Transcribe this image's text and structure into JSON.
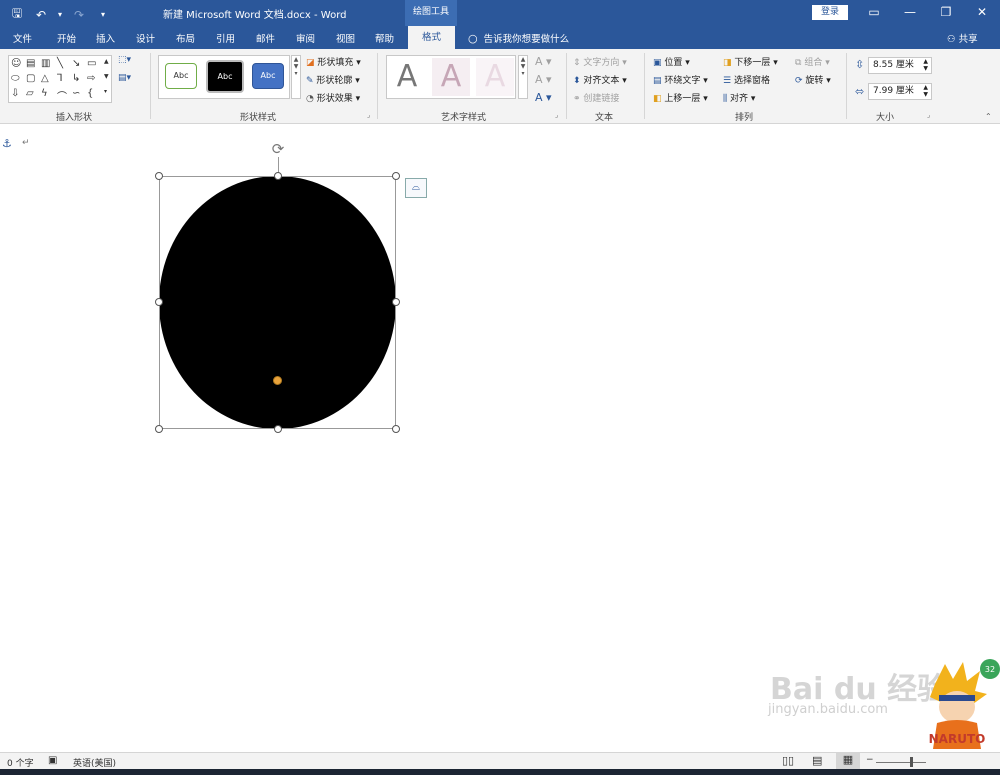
{
  "window": {
    "title": "新建 Microsoft Word 文档.docx  -  Word",
    "contextual_tools": "绘图工具",
    "login_label": "登录",
    "controls": {
      "display_options": "▭",
      "minimize": "—",
      "restore": "❐",
      "close": "✕"
    }
  },
  "qat": {
    "save": "🖫",
    "undo": "↶",
    "undo_drop": "▾",
    "redo": "↷",
    "customize": "▾"
  },
  "tabs": [
    {
      "label": "文件"
    },
    {
      "label": "开始"
    },
    {
      "label": "插入"
    },
    {
      "label": "设计"
    },
    {
      "label": "布局"
    },
    {
      "label": "引用"
    },
    {
      "label": "邮件"
    },
    {
      "label": "审阅"
    },
    {
      "label": "视图"
    },
    {
      "label": "帮助"
    },
    {
      "label": "格式"
    }
  ],
  "tell_me": "告诉我你想要做什么",
  "share": "共享",
  "ribbon": {
    "groups": {
      "insert_shapes": "插入形状",
      "shape_styles": "形状样式",
      "wordart_styles": "艺术字样式",
      "text": "文本",
      "arrange": "排列",
      "size": "大小"
    },
    "style_presets": [
      {
        "label": "Abc"
      },
      {
        "label": "Abc"
      },
      {
        "label": "Abc"
      }
    ],
    "shape_commands": {
      "fill": "形状填充",
      "outline": "形状轮廓",
      "effects": "形状效果"
    },
    "wordart_presets": [
      {
        "label": "A"
      },
      {
        "label": "A"
      },
      {
        "label": "A"
      }
    ],
    "wordart_small": [
      "A",
      "A",
      "A"
    ],
    "text_commands": {
      "direction": "文字方向",
      "align": "对齐文本",
      "link": "创建链接"
    },
    "arrange_commands": {
      "position": "位置",
      "wrap": "环绕文字",
      "forward": "上移一层",
      "backward": "下移一层",
      "selection_pane": "选择窗格",
      "align": "对齐",
      "group": "组合",
      "rotate": "旋转"
    },
    "size": {
      "height": "8.55 厘米",
      "width": "7.99 厘米"
    }
  },
  "document": {
    "anchor": "⚓",
    "para_mark": "↵"
  },
  "watermark": {
    "main": "Bai du 经验",
    "sub": "jingyan.baidu.com",
    "badge": "32",
    "mascot_text": "NARUTO"
  },
  "statusbar": {
    "words": "0 个字",
    "language": "英语(美国)"
  },
  "colors": {
    "accent": "#2b579a",
    "shape_fill": "#000000",
    "adjust_handle": "#e8a33c"
  }
}
